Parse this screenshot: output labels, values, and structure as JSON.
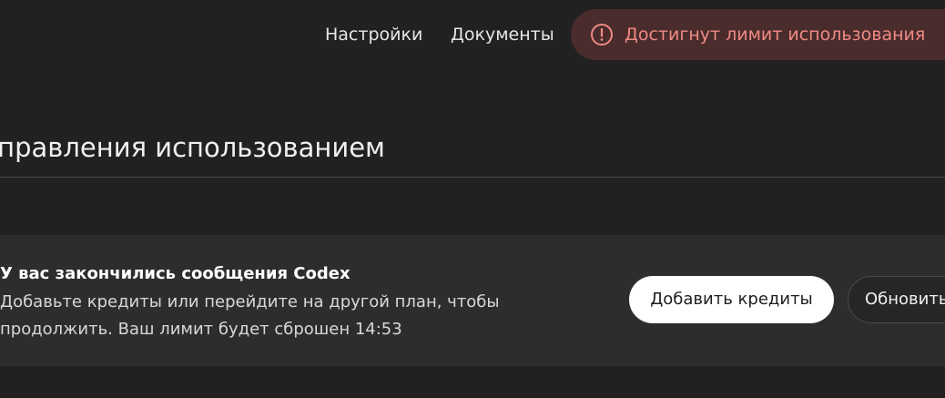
{
  "topnav": {
    "settings_label": "Настройки",
    "docs_label": "Документы",
    "limit_badge": {
      "label": "Достигнут лимит использования",
      "icon": "alert-circle-icon",
      "color": "#f08a84",
      "background": "#4a2c2c"
    }
  },
  "main": {
    "title": "управления использованием"
  },
  "alert": {
    "title": "У вас закончились сообщения Codex",
    "text_line1": "Добавьте кредиты или перейдите на другой план, чтобы",
    "text_line2": "продолжить. Ваш лимит будет сброшен 14:53",
    "add_credits_label": "Добавить кредиты",
    "upgrade_label": "Обновить"
  },
  "colors": {
    "background": "#212121",
    "card": "#2d2d2d",
    "primary_button": "#ffffff"
  }
}
